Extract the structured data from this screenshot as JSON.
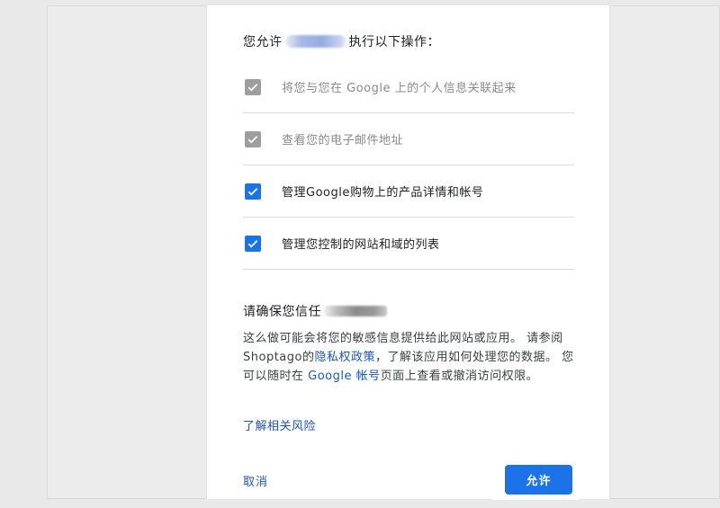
{
  "consent": {
    "heading_prefix": "您允许",
    "heading_suffix": "执行以下操作：",
    "permissions": [
      {
        "label": "将您与您在 Google 上的个人信息关联起来",
        "checked": true,
        "disabled": true
      },
      {
        "label": "查看您的电子邮件地址",
        "checked": true,
        "disabled": true
      },
      {
        "label": "管理Google购物上的产品详情和帐号",
        "checked": true,
        "disabled": false
      },
      {
        "label": "管理您控制的网站和域的列表",
        "checked": true,
        "disabled": false
      }
    ],
    "trust_title": "请确保您信任",
    "desc": {
      "part1": "这么做可能会将您的敏感信息提供给此网站或应用。 请参阅Shoptago的",
      "privacy_link": "隐私权政策",
      "part2": "，了解该应用如何处理您的数据。 您可以随时在 ",
      "account_link": "Google 帐号",
      "part3": "页面上查看或撤消访问权限。"
    },
    "risk_link": "了解相关风险",
    "cancel_label": "取消",
    "allow_label": "允许"
  },
  "colors": {
    "accent": "#1a73e8",
    "link": "#1a56c4",
    "disabled_check": "#9e9e9e"
  }
}
